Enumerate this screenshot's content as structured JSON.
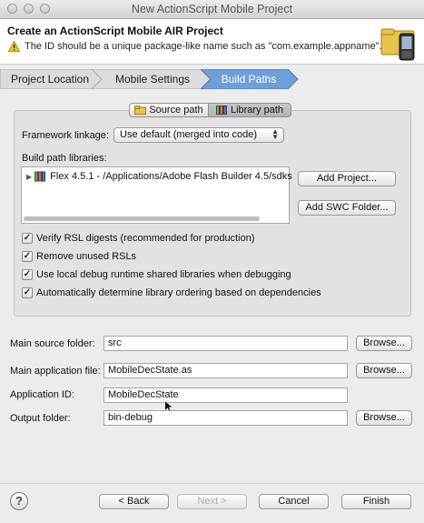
{
  "window": {
    "title": "New ActionScript Mobile Project"
  },
  "header": {
    "title": "Create an ActionScript Mobile AIR Project",
    "message": "The ID should be a unique package-like name such as \"com.example.appname\"."
  },
  "breadcrumbs": [
    {
      "label": "Project Location",
      "active": false
    },
    {
      "label": "Mobile Settings",
      "active": false
    },
    {
      "label": "Build Paths",
      "active": true
    }
  ],
  "tabs": {
    "source": "Source path",
    "library": "Library path",
    "selected": "library"
  },
  "framework": {
    "label": "Framework linkage:",
    "value": "Use default (merged into code)"
  },
  "build_path": {
    "label": "Build path libraries:",
    "items": [
      "Flex 4.5.1 - /Applications/Adobe Flash Builder 4.5/sdks"
    ]
  },
  "side_buttons": {
    "add_project": "Add Project...",
    "add_swc_folder": "Add SWC Folder..."
  },
  "options": [
    {
      "label": "Verify RSL digests (recommended for production)",
      "checked": true
    },
    {
      "label": "Remove unused RSLs",
      "checked": true
    },
    {
      "label": "Use local debug runtime shared libraries when debugging",
      "checked": true
    },
    {
      "label": "Automatically determine library ordering based on dependencies",
      "checked": true
    }
  ],
  "fields": {
    "main_source_folder": {
      "label": "Main source folder:",
      "value": "src",
      "browse": "Browse..."
    },
    "main_app_file": {
      "label": "Main application file:",
      "value": "MobileDecState.as",
      "browse": "Browse..."
    },
    "app_id": {
      "label": "Application ID:",
      "value": "MobileDecState"
    },
    "output_folder": {
      "label": "Output folder:",
      "value": "bin-debug",
      "browse": "Browse..."
    }
  },
  "footer": {
    "help": "?",
    "back": "< Back",
    "next": "Next >",
    "cancel": "Cancel",
    "finish": "Finish"
  },
  "colors": {
    "active_crumb": "#6f9fd8",
    "crumb": "#dcdcdc"
  }
}
